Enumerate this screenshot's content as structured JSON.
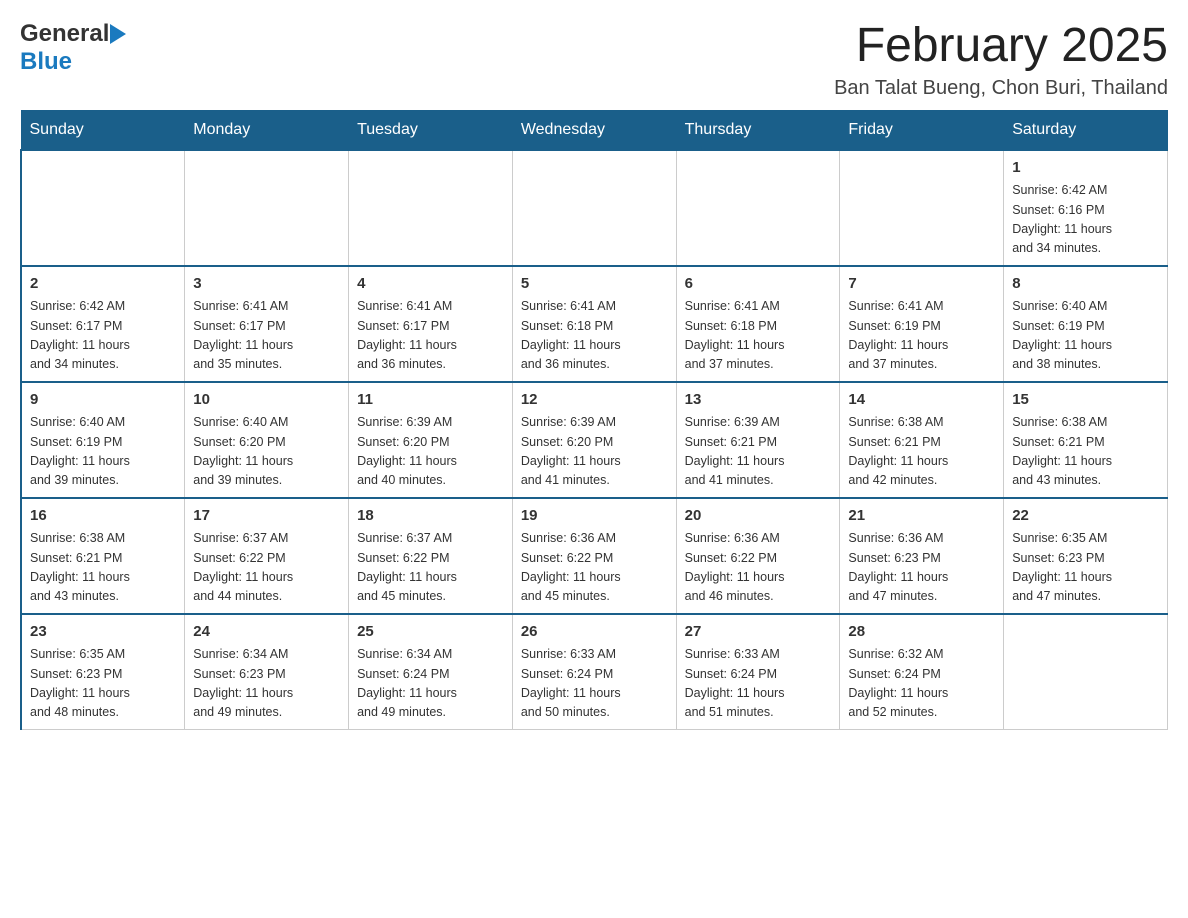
{
  "logo": {
    "general": "General",
    "blue": "Blue"
  },
  "header": {
    "title": "February 2025",
    "location": "Ban Talat Bueng, Chon Buri, Thailand"
  },
  "days_of_week": [
    "Sunday",
    "Monday",
    "Tuesday",
    "Wednesday",
    "Thursday",
    "Friday",
    "Saturday"
  ],
  "weeks": [
    [
      {
        "day": "",
        "info": ""
      },
      {
        "day": "",
        "info": ""
      },
      {
        "day": "",
        "info": ""
      },
      {
        "day": "",
        "info": ""
      },
      {
        "day": "",
        "info": ""
      },
      {
        "day": "",
        "info": ""
      },
      {
        "day": "1",
        "info": "Sunrise: 6:42 AM\nSunset: 6:16 PM\nDaylight: 11 hours\nand 34 minutes."
      }
    ],
    [
      {
        "day": "2",
        "info": "Sunrise: 6:42 AM\nSunset: 6:17 PM\nDaylight: 11 hours\nand 34 minutes."
      },
      {
        "day": "3",
        "info": "Sunrise: 6:41 AM\nSunset: 6:17 PM\nDaylight: 11 hours\nand 35 minutes."
      },
      {
        "day": "4",
        "info": "Sunrise: 6:41 AM\nSunset: 6:17 PM\nDaylight: 11 hours\nand 36 minutes."
      },
      {
        "day": "5",
        "info": "Sunrise: 6:41 AM\nSunset: 6:18 PM\nDaylight: 11 hours\nand 36 minutes."
      },
      {
        "day": "6",
        "info": "Sunrise: 6:41 AM\nSunset: 6:18 PM\nDaylight: 11 hours\nand 37 minutes."
      },
      {
        "day": "7",
        "info": "Sunrise: 6:41 AM\nSunset: 6:19 PM\nDaylight: 11 hours\nand 37 minutes."
      },
      {
        "day": "8",
        "info": "Sunrise: 6:40 AM\nSunset: 6:19 PM\nDaylight: 11 hours\nand 38 minutes."
      }
    ],
    [
      {
        "day": "9",
        "info": "Sunrise: 6:40 AM\nSunset: 6:19 PM\nDaylight: 11 hours\nand 39 minutes."
      },
      {
        "day": "10",
        "info": "Sunrise: 6:40 AM\nSunset: 6:20 PM\nDaylight: 11 hours\nand 39 minutes."
      },
      {
        "day": "11",
        "info": "Sunrise: 6:39 AM\nSunset: 6:20 PM\nDaylight: 11 hours\nand 40 minutes."
      },
      {
        "day": "12",
        "info": "Sunrise: 6:39 AM\nSunset: 6:20 PM\nDaylight: 11 hours\nand 41 minutes."
      },
      {
        "day": "13",
        "info": "Sunrise: 6:39 AM\nSunset: 6:21 PM\nDaylight: 11 hours\nand 41 minutes."
      },
      {
        "day": "14",
        "info": "Sunrise: 6:38 AM\nSunset: 6:21 PM\nDaylight: 11 hours\nand 42 minutes."
      },
      {
        "day": "15",
        "info": "Sunrise: 6:38 AM\nSunset: 6:21 PM\nDaylight: 11 hours\nand 43 minutes."
      }
    ],
    [
      {
        "day": "16",
        "info": "Sunrise: 6:38 AM\nSunset: 6:21 PM\nDaylight: 11 hours\nand 43 minutes."
      },
      {
        "day": "17",
        "info": "Sunrise: 6:37 AM\nSunset: 6:22 PM\nDaylight: 11 hours\nand 44 minutes."
      },
      {
        "day": "18",
        "info": "Sunrise: 6:37 AM\nSunset: 6:22 PM\nDaylight: 11 hours\nand 45 minutes."
      },
      {
        "day": "19",
        "info": "Sunrise: 6:36 AM\nSunset: 6:22 PM\nDaylight: 11 hours\nand 45 minutes."
      },
      {
        "day": "20",
        "info": "Sunrise: 6:36 AM\nSunset: 6:22 PM\nDaylight: 11 hours\nand 46 minutes."
      },
      {
        "day": "21",
        "info": "Sunrise: 6:36 AM\nSunset: 6:23 PM\nDaylight: 11 hours\nand 47 minutes."
      },
      {
        "day": "22",
        "info": "Sunrise: 6:35 AM\nSunset: 6:23 PM\nDaylight: 11 hours\nand 47 minutes."
      }
    ],
    [
      {
        "day": "23",
        "info": "Sunrise: 6:35 AM\nSunset: 6:23 PM\nDaylight: 11 hours\nand 48 minutes."
      },
      {
        "day": "24",
        "info": "Sunrise: 6:34 AM\nSunset: 6:23 PM\nDaylight: 11 hours\nand 49 minutes."
      },
      {
        "day": "25",
        "info": "Sunrise: 6:34 AM\nSunset: 6:24 PM\nDaylight: 11 hours\nand 49 minutes."
      },
      {
        "day": "26",
        "info": "Sunrise: 6:33 AM\nSunset: 6:24 PM\nDaylight: 11 hours\nand 50 minutes."
      },
      {
        "day": "27",
        "info": "Sunrise: 6:33 AM\nSunset: 6:24 PM\nDaylight: 11 hours\nand 51 minutes."
      },
      {
        "day": "28",
        "info": "Sunrise: 6:32 AM\nSunset: 6:24 PM\nDaylight: 11 hours\nand 52 minutes."
      },
      {
        "day": "",
        "info": ""
      }
    ]
  ]
}
